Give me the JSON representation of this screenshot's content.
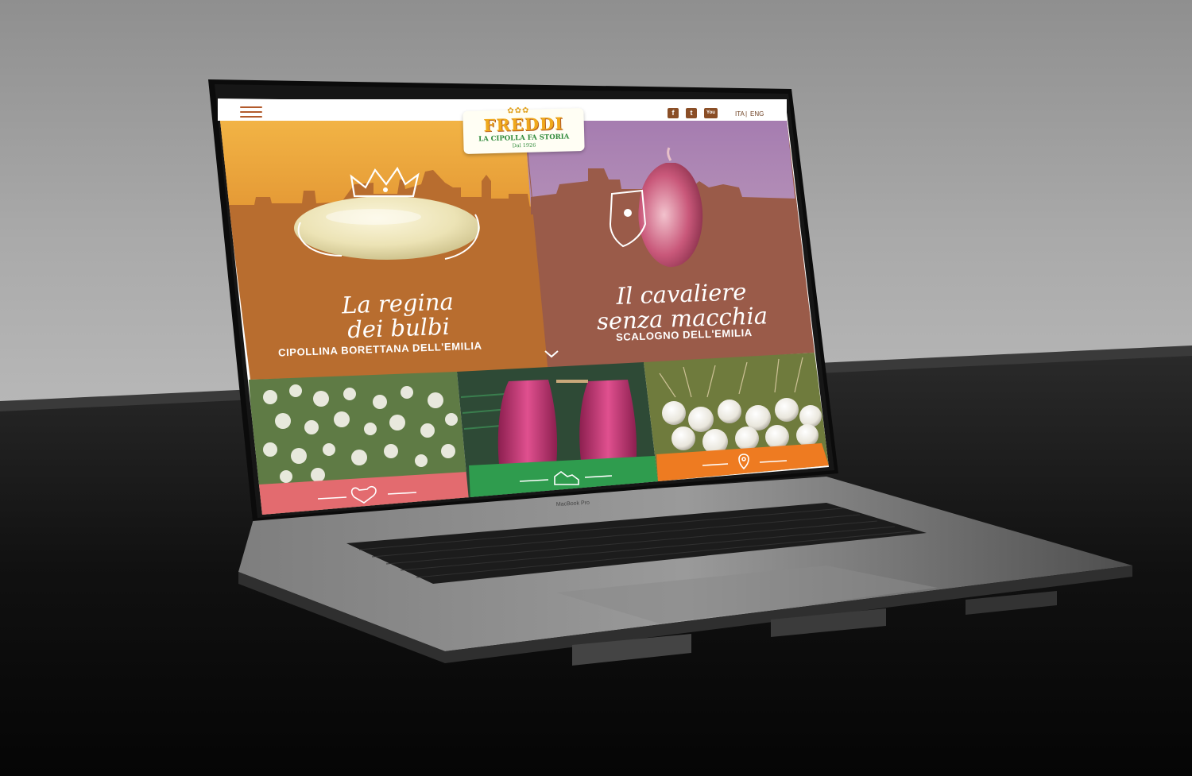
{
  "header": {
    "logo": {
      "name": "FREDDI",
      "tagline": "LA CIPOLLA FA STORIA",
      "since": "Dal 1926"
    },
    "social": [
      {
        "name": "facebook-icon",
        "glyph": "f"
      },
      {
        "name": "twitter-icon",
        "glyph": "t"
      },
      {
        "name": "youtube-icon",
        "glyph": "You"
      }
    ],
    "languages": [
      "ITA",
      "ENG"
    ],
    "separator": "|"
  },
  "hero": {
    "left": {
      "title_line1": "La regina",
      "title_line2": "dei bulbi",
      "subtitle": "CIPOLLINA BORETTANA DELL'EMILIA",
      "bg_top": "#f2a93b",
      "bg": "#b86d2f"
    },
    "right": {
      "title_line1": "Il cavaliere",
      "title_line2": "senza macchia",
      "subtitle": "SCALOGNO DELL'EMILIA",
      "bg_top": "#a77aab",
      "bg": "#9a5b49"
    }
  },
  "tiles": [
    {
      "name": "tile-flowers",
      "icon": "heart-icon",
      "band_color": "#e36b6f"
    },
    {
      "name": "tile-shallots",
      "icon": "farm-icon",
      "band_color": "#2f9c4e"
    },
    {
      "name": "tile-onions",
      "icon": "location-pin-icon",
      "band_color": "#ee7b21"
    }
  ],
  "colors": {
    "brand_orange": "#f0a91c",
    "brand_green": "#2f8a3a",
    "brand_brown": "#8a4e26"
  }
}
